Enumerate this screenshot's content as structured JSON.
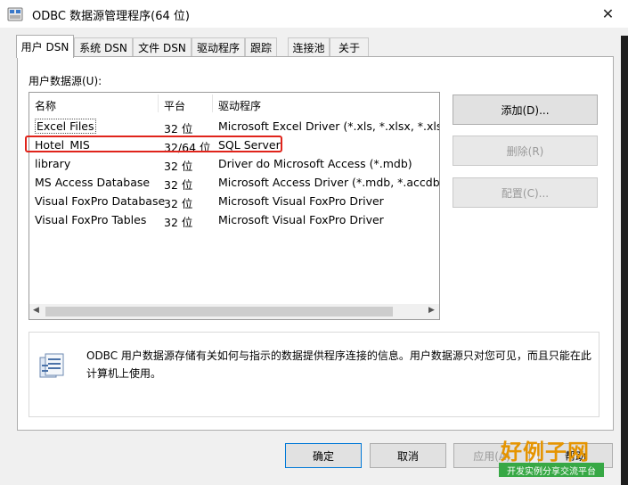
{
  "window": {
    "title": "ODBC 数据源管理程序(64 位)",
    "close_glyph": "✕"
  },
  "tabs": [
    {
      "label": "用户 DSN"
    },
    {
      "label": "系统 DSN"
    },
    {
      "label": "文件 DSN"
    },
    {
      "label": "驱动程序"
    },
    {
      "label": "跟踪"
    },
    {
      "label": "连接池"
    },
    {
      "label": "关于"
    }
  ],
  "panel": {
    "group_label": "用户数据源(U):",
    "columns": {
      "name": "名称",
      "platform": "平台",
      "driver": "驱动程序"
    },
    "rows": [
      {
        "name": "Excel Files",
        "platform": "32 位",
        "driver": "Microsoft Excel Driver (*.xls, *.xlsx, *.xlsm, *"
      },
      {
        "name": "Hotel_MIS",
        "platform": "32/64 位",
        "driver": "SQL Server"
      },
      {
        "name": "library",
        "platform": "32 位",
        "driver": "Driver do Microsoft Access (*.mdb)"
      },
      {
        "name": "MS Access Database",
        "platform": "32 位",
        "driver": "Microsoft Access Driver (*.mdb, *.accdb)"
      },
      {
        "name": "Visual FoxPro Database",
        "platform": "32 位",
        "driver": "Microsoft Visual FoxPro Driver"
      },
      {
        "name": "Visual FoxPro Tables",
        "platform": "32 位",
        "driver": "Microsoft Visual FoxPro Driver"
      }
    ],
    "scroll_left": "◀",
    "scroll_right": "▶",
    "side_buttons": {
      "add": "添加(D)...",
      "remove": "删除(R)",
      "configure": "配置(C)..."
    },
    "info_text": "ODBC 用户数据源存储有关如何与指示的数据提供程序连接的信息。用户数据源只对您可见，而且只能在此计算机上使用。"
  },
  "footer": {
    "ok": "确定",
    "cancel": "取消",
    "apply": "应用(A)",
    "help": "帮助"
  },
  "watermark": {
    "big": "好例子网",
    "small": "开发实例分享交流平台"
  },
  "colors": {
    "accent": "#0078d7",
    "highlight": "#e0241b"
  }
}
